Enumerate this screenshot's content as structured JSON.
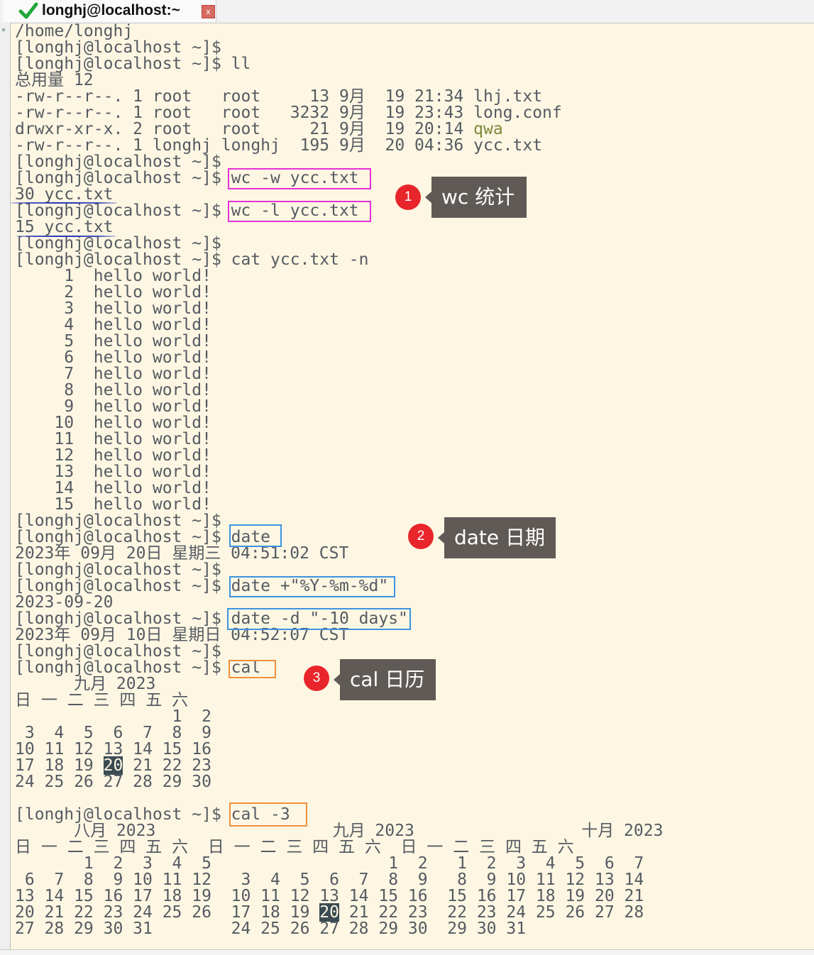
{
  "tab": {
    "title": "longhj@localhost:~",
    "close": "x"
  },
  "lines": [
    "/home/longhj",
    "[longhj@localhost ~]$",
    "[longhj@localhost ~]$ ll",
    "总用量 12",
    "-rw-r--r--. 1 root   root     13 9月  19 21:34 lhj.txt",
    "-rw-r--r--. 1 root   root   3232 9月  19 23:43 long.conf",
    "drwxr-xr-x. 2 root   root     21 9月  19 20:14 ",
    "-rw-r--r--. 1 longhj longhj  195 9月  20 04:36 ycc.txt",
    "[longhj@localhost ~]$",
    "[longhj@localhost ~]$ wc -w ycc.txt",
    "30 ycc.txt",
    "[longhj@localhost ~]$ wc -l ycc.txt",
    "15 ycc.txt",
    "[longhj@localhost ~]$",
    "[longhj@localhost ~]$ cat ycc.txt -n",
    "     1  hello world!",
    "     2  hello world!",
    "     3  hello world!",
    "     4  hello world!",
    "     5  hello world!",
    "     6  hello world!",
    "     7  hello world!",
    "     8  hello world!",
    "     9  hello world!",
    "    10  hello world!",
    "    11  hello world!",
    "    12  hello world!",
    "    13  hello world!",
    "    14  hello world!",
    "    15  hello world!",
    "[longhj@localhost ~]$",
    "[longhj@localhost ~]$ date",
    "2023年 09月 20日 星期三 04:51:02 CST",
    "[longhj@localhost ~]$",
    "[longhj@localhost ~]$ date +\"%Y-%m-%d\"",
    "2023-09-20",
    "[longhj@localhost ~]$ date -d \"-10 days\"",
    "2023年 09月 10日 星期日 04:52:07 CST",
    "[longhj@localhost ~]$",
    "[longhj@localhost ~]$ cal",
    "      九月 2023",
    "日 一 二 三 四 五 六",
    "                1  2",
    " 3  4  5  6  7  8  9",
    "10 11 12 13 14 15 16",
    "17 18 19 ",
    "24 25 26 27 28 29 30",
    "",
    "[longhj@localhost ~]$ cal -3",
    "      八月 2023                  九月 2023                 十月 2023",
    "日 一 二 三 四 五 六  日 一 二 三 四 五 六  日 一 二 三 四 五 六",
    "       1  2  3  4  5                  1  2   1  2  3  4  5  6  7",
    " 6  7  8  9 10 11 12   3  4  5  6  7  8  9   8  9 10 11 12 13 14",
    "13 14 15 16 17 18 19  10 11 12 13 14 15 16  15 16 17 18 19 20 21",
    "20 21 22 23 24 25 26  17 18 19 ",
    "27 28 29 30 31        24 25 26 27 28 29 30  29 30 31"
  ],
  "dir_name": "qwa",
  "today_hl": "20",
  "today_tail_1": " 21 22 23",
  "today_tail_2": " 21 22 23  22 23 24 25 26 27 28",
  "annotations": [
    {
      "num": "1",
      "label": "wc 统计"
    },
    {
      "num": "2",
      "label": "date 日期"
    },
    {
      "num": "3",
      "label": "cal 日历"
    }
  ]
}
